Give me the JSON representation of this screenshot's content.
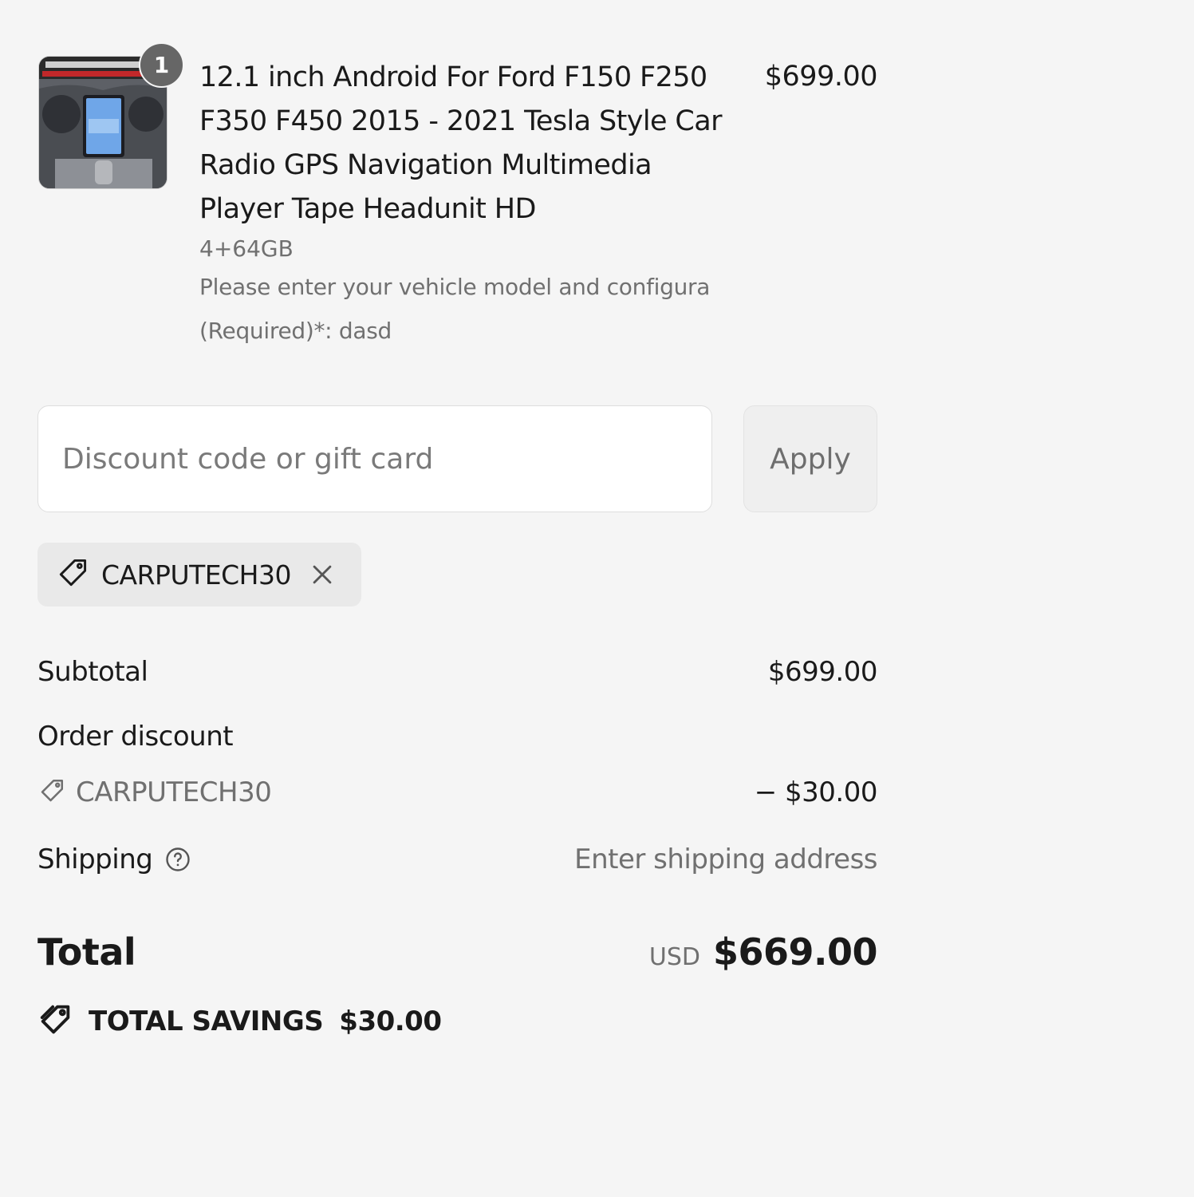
{
  "product": {
    "title": "12.1 inch Android For Ford F150 F250 F350 F450 2015 - 2021 Tesla Style Car Radio GPS Navigation Multimedia Player Tape Headunit HD",
    "quantity": "1",
    "variant": "4+64GB",
    "property": "Please enter your vehicle model and configura (Required)*: dasd",
    "price": "$699.00",
    "image_icon": "car-radio-thumbnail"
  },
  "discount": {
    "placeholder": "Discount code or gift card",
    "apply_label": "Apply",
    "applied_code": "CARPUTECH30"
  },
  "summary": {
    "subtotal_label": "Subtotal",
    "subtotal_value": "$699.00",
    "order_discount_label": "Order discount",
    "discount_code": "CARPUTECH30",
    "discount_value": "− $30.00",
    "shipping_label": "Shipping",
    "shipping_value": "Enter shipping address",
    "total_label": "Total",
    "currency": "USD",
    "total_value": "$669.00",
    "savings_label": "TOTAL SAVINGS",
    "savings_value": "$30.00"
  },
  "colors": {
    "background": "#f5f5f5",
    "text": "#1a1a1a",
    "muted": "#707070",
    "badge": "#666666"
  }
}
